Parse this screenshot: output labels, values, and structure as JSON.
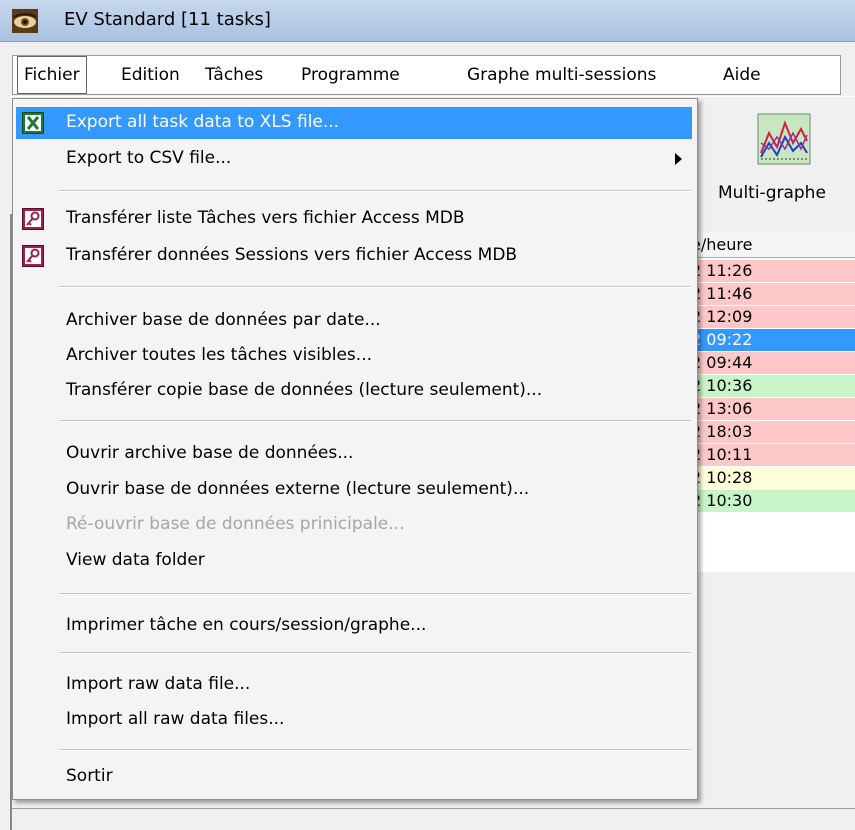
{
  "window": {
    "title": "EV Standard [11 tasks]"
  },
  "menubar": {
    "items": [
      "Fichier",
      "Edition",
      "Tâches",
      "Programme",
      "Graphe multi-sessions",
      "Aide"
    ]
  },
  "toolbar": {
    "multigraph_label": "Multi-graphe"
  },
  "table": {
    "header": "e/heure",
    "rows": [
      {
        "time": "2 11:26",
        "color": "#ffc8c8"
      },
      {
        "time": "2 11:46",
        "color": "#ffc8c8"
      },
      {
        "time": "2 12:09",
        "color": "#ffc8c8"
      },
      {
        "time": "2 09:22",
        "color": "#3399ff"
      },
      {
        "time": "2 09:44",
        "color": "#ffc8c8"
      },
      {
        "time": "2 10:36",
        "color": "#c8f5c8"
      },
      {
        "time": "2 13:06",
        "color": "#ffc8c8"
      },
      {
        "time": "2 18:03",
        "color": "#ffc8c8"
      },
      {
        "time": "2 10:11",
        "color": "#ffc8c8"
      },
      {
        "time": "2 10:28",
        "color": "#ffffdc"
      },
      {
        "time": "2 10:30",
        "color": "#c8f5c8"
      }
    ]
  },
  "dropdown": {
    "items": [
      {
        "label": "Export all task data to XLS file...",
        "icon": "excel-icon"
      },
      {
        "label": "Export to CSV file...",
        "submenu": true
      },
      {
        "label": "Transférer liste Tâches vers fichier Access MDB",
        "icon": "access-key-icon"
      },
      {
        "label": "Transférer données Sessions vers fichier Access MDB",
        "icon": "access-key-icon"
      },
      {
        "label": "Archiver base de données par date..."
      },
      {
        "label": "Archiver toutes les tâches visibles..."
      },
      {
        "label": "Transférer copie base de données (lecture seulement)..."
      },
      {
        "label": "Ouvrir archive base de données..."
      },
      {
        "label": "Ouvrir base de données externe (lecture seulement)..."
      },
      {
        "label": "Ré-ouvrir base de données prinicipale...",
        "disabled": true
      },
      {
        "label": "View data folder"
      },
      {
        "label": "Imprimer tâche en cours/session/graphe..."
      },
      {
        "label": "Import raw data file..."
      },
      {
        "label": "Import all raw data files..."
      },
      {
        "label": "Sortir"
      }
    ]
  },
  "colors": {
    "highlight": "#3399ff",
    "selected_row": "#3399ff"
  }
}
